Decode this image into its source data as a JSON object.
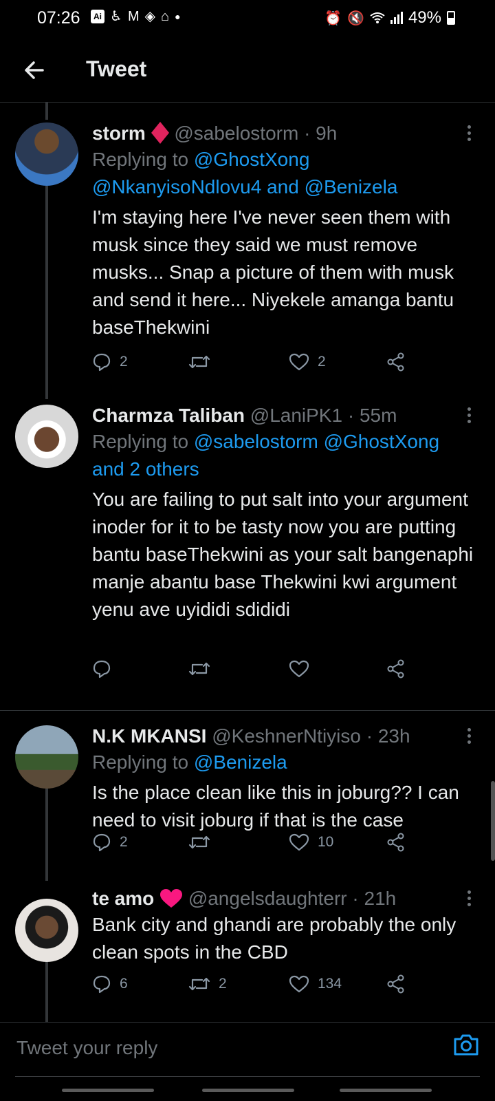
{
  "status_bar": {
    "time": "07:26",
    "ai_badge": "Ai",
    "left_icons": [
      "accessibility-icon",
      "gmail-icon",
      "code-icon",
      "home-icon",
      "dot-icon"
    ],
    "right_icons": [
      "alarm-icon",
      "mute-icon",
      "wifi-icon",
      "signal-icon"
    ],
    "battery": "49%"
  },
  "header": {
    "title": "Tweet"
  },
  "tweets": [
    {
      "name": "storm",
      "badge_color": "#e0245e",
      "handle": "@sabelostorm",
      "time": " · 9h",
      "replying_prefix": "Replying to ",
      "replying_line1": "@GhostXong",
      "replying_line2": "@NkanyisoNdlovu4 and @Benizela",
      "text": "I'm staying here I've never seen them with musk since they said we must remove musks... Snap a picture of them with musk and send it here... Niyekele amanga bantu baseThekwini",
      "replies": "2",
      "retweets": "",
      "likes": "2"
    },
    {
      "name": "Charmza Taliban",
      "handle": "@LaniPK1",
      "time": " · 55m",
      "replying_prefix": "Replying to ",
      "replying_line1": "@sabelostorm @GhostXong",
      "replying_line2": "and 2 others",
      "text": "You are failing to put salt into your argument inoder for it to be tasty now you are putting bantu baseThekwini as your salt bangenaphi manje abantu base Thekwini kwi argument yenu ave uyididi sdididi",
      "replies": "",
      "retweets": "",
      "likes": ""
    },
    {
      "name": "N.K MKANSI",
      "handle": "@KeshnerNtiyiso",
      "time": " · 23h",
      "replying_prefix": "Replying to ",
      "replying_line1": "@Benizela",
      "text": "Is the place clean like this in joburg?? I can need to visit joburg if that is the case",
      "replies": "2",
      "retweets": "",
      "likes": "10"
    },
    {
      "name": "te amo",
      "badge_color": "#f91880",
      "handle": "@angelsdaughterr",
      "time": " · 21h",
      "text": "Bank city and ghandi are probably the only clean spots in the CBD",
      "replies": "6",
      "retweets": "2",
      "likes": "134"
    }
  ],
  "composer": {
    "placeholder": "Tweet your reply",
    "camera_icon": "camera-icon"
  },
  "colors": {
    "link": "#1d9bf0",
    "muted": "#71767b",
    "background": "#000000"
  }
}
